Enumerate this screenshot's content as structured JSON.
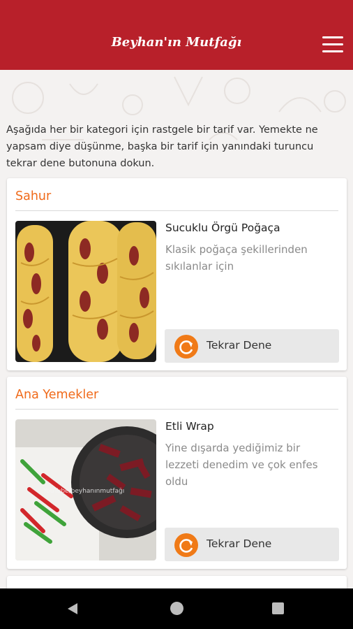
{
  "header": {
    "title": "Beyhan'ın Mutfağı"
  },
  "intro": "Aşağıda her bir kategori için rastgele bir tarif var. Yemekte ne yapsam diye düşünme, başka bir tarif için yanındaki turuncu tekrar dene butonuna dokun.",
  "cards": [
    {
      "category": "Sahur",
      "recipe_name": "Sucuklu Örgü Poğaça",
      "recipe_desc": "Klasik poğaça şekillerinden sıkılanlar için",
      "button_label": "Tekrar Dene"
    },
    {
      "category": "Ana Yemekler",
      "recipe_name": "Etli Wrap",
      "recipe_desc": "Yine dışarda yediğimiz bir lezzeti denedim ve çok enfes oldu",
      "button_label": "Tekrar Dene",
      "watermark": "YouTube/beyhanınmutfağı"
    }
  ],
  "colors": {
    "header": "#b8202a",
    "accent": "#f06a1a",
    "retry_icon": "#f07a17"
  },
  "icons": {
    "menu": "hamburger-menu-icon",
    "retry": "refresh-icon",
    "nav_back": "back-triangle-icon",
    "nav_home": "home-circle-icon",
    "nav_recent": "recent-square-icon"
  }
}
